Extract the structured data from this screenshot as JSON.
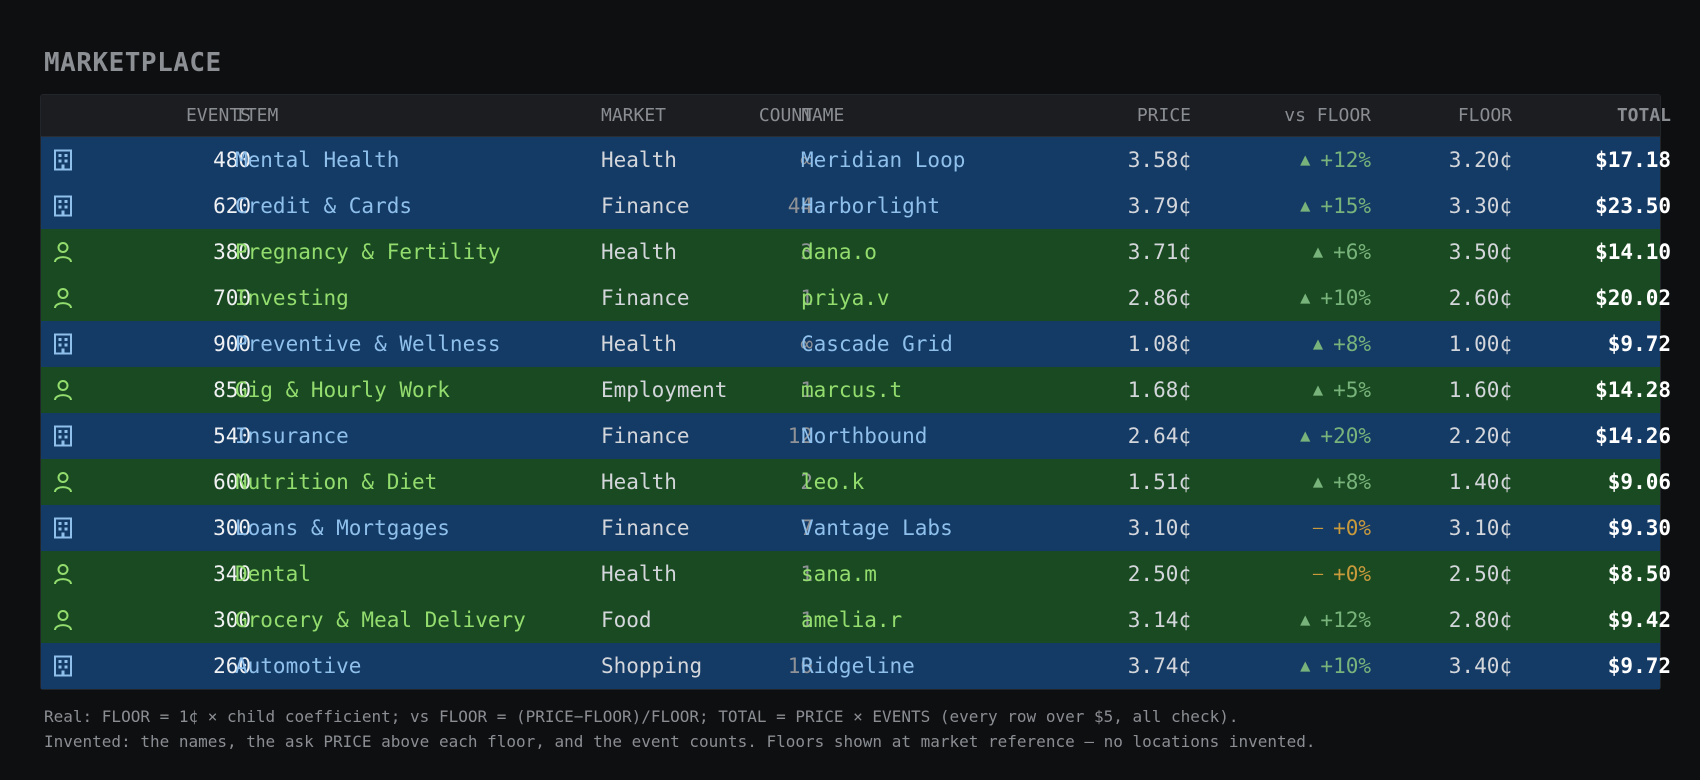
{
  "title": "MARKETPLACE",
  "columns": {
    "events": "EVENTS",
    "item": "ITEM",
    "market": "MARKET",
    "count": "COUNT",
    "name": "NAME",
    "price": "PRICE",
    "vs_floor": "vs FLOOR",
    "floor": "FLOOR",
    "total": "TOTAL"
  },
  "colors": {
    "company_row": "#143a66",
    "person_row": "#1a4a21",
    "up": "#78b37b",
    "flat": "#c89a3c"
  },
  "rows": [
    {
      "type": "company",
      "icon": "building-icon",
      "events": "480",
      "item": "Mental Health",
      "market": "Health",
      "count": "∞",
      "name": "Meridian Loop",
      "price": "3.58¢",
      "arrow": "▲",
      "trend": "up",
      "vs": "+12%",
      "floor": "3.20¢",
      "total": "$17.18"
    },
    {
      "type": "company",
      "icon": "building-icon",
      "events": "620",
      "item": "Credit & Cards",
      "market": "Finance",
      "count": "44",
      "name": "Harborlight",
      "price": "3.79¢",
      "arrow": "▲",
      "trend": "up",
      "vs": "+15%",
      "floor": "3.30¢",
      "total": "$23.50"
    },
    {
      "type": "person",
      "icon": "person-icon",
      "events": "380",
      "item": "Pregnancy & Fertility",
      "market": "Health",
      "count": "3",
      "name": "dana.o",
      "price": "3.71¢",
      "arrow": "▲",
      "trend": "up",
      "vs": "+6%",
      "floor": "3.50¢",
      "total": "$14.10"
    },
    {
      "type": "person",
      "icon": "person-icon",
      "events": "700",
      "item": "Investing",
      "market": "Finance",
      "count": "1",
      "name": "priya.v",
      "price": "2.86¢",
      "arrow": "▲",
      "trend": "up",
      "vs": "+10%",
      "floor": "2.60¢",
      "total": "$20.02"
    },
    {
      "type": "company",
      "icon": "building-icon",
      "events": "900",
      "item": "Preventive & Wellness",
      "market": "Health",
      "count": "∞",
      "name": "Cascade Grid",
      "price": "1.08¢",
      "arrow": "▲",
      "trend": "up",
      "vs": "+8%",
      "floor": "1.00¢",
      "total": "$9.72"
    },
    {
      "type": "person",
      "icon": "person-icon",
      "events": "850",
      "item": "Gig & Hourly Work",
      "market": "Employment",
      "count": "1",
      "name": "marcus.t",
      "price": "1.68¢",
      "arrow": "▲",
      "trend": "up",
      "vs": "+5%",
      "floor": "1.60¢",
      "total": "$14.28"
    },
    {
      "type": "company",
      "icon": "building-icon",
      "events": "540",
      "item": "Insurance",
      "market": "Finance",
      "count": "12",
      "name": "Northbound",
      "price": "2.64¢",
      "arrow": "▲",
      "trend": "up",
      "vs": "+20%",
      "floor": "2.20¢",
      "total": "$14.26"
    },
    {
      "type": "person",
      "icon": "person-icon",
      "events": "600",
      "item": "Nutrition & Diet",
      "market": "Health",
      "count": "2",
      "name": "leo.k",
      "price": "1.51¢",
      "arrow": "▲",
      "trend": "up",
      "vs": "+8%",
      "floor": "1.40¢",
      "total": "$9.06"
    },
    {
      "type": "company",
      "icon": "building-icon",
      "events": "300",
      "item": "Loans & Mortgages",
      "market": "Finance",
      "count": "7",
      "name": "Vantage Labs",
      "price": "3.10¢",
      "arrow": "—",
      "trend": "flat",
      "vs": "+0%",
      "floor": "3.10¢",
      "total": "$9.30"
    },
    {
      "type": "person",
      "icon": "person-icon",
      "events": "340",
      "item": "Dental",
      "market": "Health",
      "count": "1",
      "name": "sana.m",
      "price": "2.50¢",
      "arrow": "—",
      "trend": "flat",
      "vs": "+0%",
      "floor": "2.50¢",
      "total": "$8.50"
    },
    {
      "type": "person",
      "icon": "person-icon",
      "events": "300",
      "item": "Grocery & Meal Delivery",
      "market": "Food",
      "count": "1",
      "name": "amelia.r",
      "price": "3.14¢",
      "arrow": "▲",
      "trend": "up",
      "vs": "+12%",
      "floor": "2.80¢",
      "total": "$9.42"
    },
    {
      "type": "company",
      "icon": "building-icon",
      "events": "260",
      "item": "Automotive",
      "market": "Shopping",
      "count": "10",
      "name": "Ridgeline",
      "price": "3.74¢",
      "arrow": "▲",
      "trend": "up",
      "vs": "+10%",
      "floor": "3.40¢",
      "total": "$9.72"
    }
  ],
  "footer": {
    "line1": "Real: FLOOR = 1¢ × child coefficient; vs FLOOR = (PRICE−FLOOR)/FLOOR; TOTAL = PRICE × EVENTS (every row over $5, all check).",
    "line2": "Invented: the names, the ask PRICE above each floor, and the event counts. Floors shown at market reference — no locations invented."
  }
}
